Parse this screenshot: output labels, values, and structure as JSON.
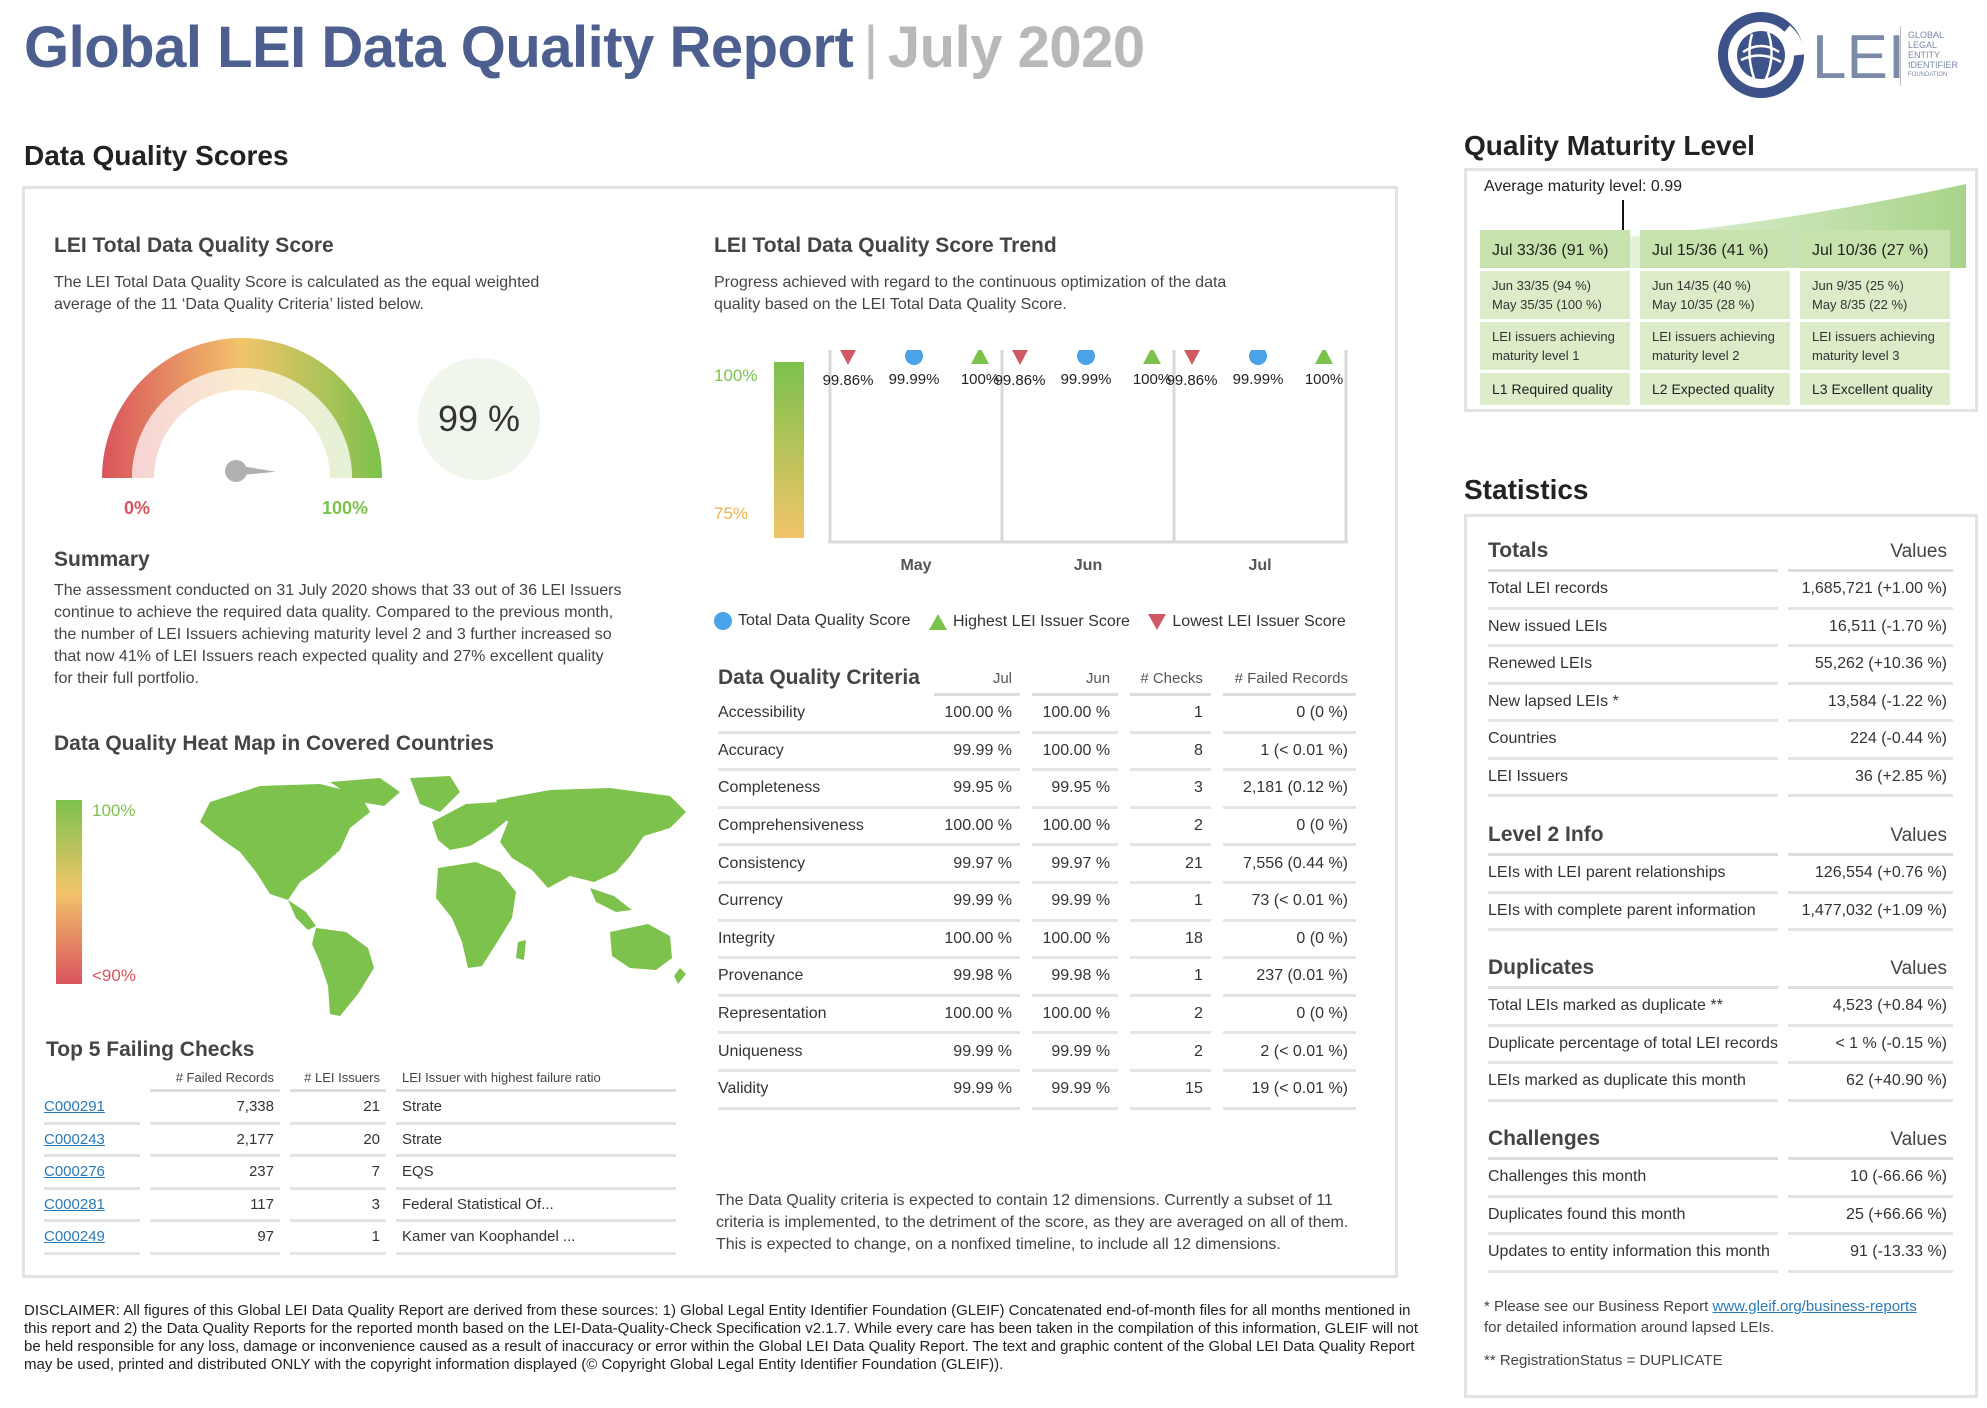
{
  "header": {
    "title": "Global LEI Data Quality Report",
    "separator": "|",
    "date": "July 2020",
    "logo_text": "LEI",
    "logo_small": [
      "GLOBAL",
      "LEGAL",
      "ENTITY",
      "IDENTIFIER",
      "FOUNDATION"
    ]
  },
  "dq_scores": {
    "section_title": "Data Quality Scores",
    "total": {
      "title": "LEI Total Data Quality Score",
      "description": "The LEI Total Data Quality Score is calculated as the equal weighted average of the 11 ‘Data Quality Criteria’ listed below.",
      "gauge_min_label": "0%",
      "gauge_max_label": "100%",
      "gauge_value": 0.99,
      "score": "99 %"
    },
    "summary": {
      "title": "Summary",
      "text": "The assessment conducted on 31 July 2020 shows that 33 out of 36 LEI Issuers continue to achieve the required data quality. Compared to the previous month, the number of LEI Issuers achieving maturity level 2 and 3 further increased so that now 41% of LEI Issuers reach expected quality and 27% excellent quality for their full portfolio."
    },
    "heatmap": {
      "title": "Data Quality Heat Map in Covered Countries",
      "max_label": "100%",
      "min_label": "<90%"
    },
    "top5": {
      "title": "Top 5 Failing Checks",
      "columns": [
        "# Failed Records",
        "# LEI Issuers",
        "LEI Issuer with highest failure ratio"
      ],
      "rows": [
        {
          "check": "C000291",
          "failed": "7,338",
          "issuers": "21",
          "issuer": "Strate"
        },
        {
          "check": "C000243",
          "failed": "2,177",
          "issuers": "20",
          "issuer": "Strate"
        },
        {
          "check": "C000276",
          "failed": "237",
          "issuers": "7",
          "issuer": "EQS"
        },
        {
          "check": "C000281",
          "failed": "117",
          "issuers": "3",
          "issuer": "Federal Statistical Of..."
        },
        {
          "check": "C000249",
          "failed": "97",
          "issuers": "1",
          "issuer": "Kamer van Koophandel ..."
        }
      ]
    },
    "trend": {
      "title": "LEI Total Data Quality Score Trend",
      "description": "Progress achieved with regard to the continuous optimization of the data quality based on the LEI Total Data Quality Score.",
      "scale_top": "100%",
      "scale_bottom": "75%",
      "legend": {
        "total": "Total Data Quality Score",
        "highest": "Highest LEI Issuer Score",
        "lowest": "Lowest LEI Issuer Score"
      },
      "colors": {
        "total": "#4aa3e8",
        "highest": "#7cc24c",
        "lowest": "#d05a64"
      }
    },
    "criteria": {
      "title": "Data Quality Criteria",
      "columns": [
        "Jul",
        "Jun",
        "# Checks",
        "# Failed Records"
      ],
      "rows": [
        {
          "name": "Accessibility",
          "jul": "100.00 %",
          "jun": "100.00 %",
          "checks": "1",
          "failed": "0 (0 %)"
        },
        {
          "name": "Accuracy",
          "jul": "99.99 %",
          "jun": "100.00 %",
          "checks": "8",
          "failed": "1 (< 0.01 %)"
        },
        {
          "name": "Completeness",
          "jul": "99.95 %",
          "jun": "99.95 %",
          "checks": "3",
          "failed": "2,181 (0.12 %)"
        },
        {
          "name": "Comprehensiveness",
          "jul": "100.00 %",
          "jun": "100.00 %",
          "checks": "2",
          "failed": "0 (0 %)"
        },
        {
          "name": "Consistency",
          "jul": "99.97 %",
          "jun": "99.97 %",
          "checks": "21",
          "failed": "7,556 (0.44 %)"
        },
        {
          "name": "Currency",
          "jul": "99.99 %",
          "jun": "99.99 %",
          "checks": "1",
          "failed": "73 (< 0.01 %)"
        },
        {
          "name": "Integrity",
          "jul": "100.00 %",
          "jun": "100.00 %",
          "checks": "18",
          "failed": "0 (0 %)"
        },
        {
          "name": "Provenance",
          "jul": "99.98 %",
          "jun": "99.98 %",
          "checks": "1",
          "failed": "237 (0.01 %)"
        },
        {
          "name": "Representation",
          "jul": "100.00 %",
          "jun": "100.00 %",
          "checks": "2",
          "failed": "0 (0 %)"
        },
        {
          "name": "Uniqueness",
          "jul": "99.99 %",
          "jun": "99.99 %",
          "checks": "2",
          "failed": "2 (< 0.01 %)"
        },
        {
          "name": "Validity",
          "jul": "99.99 %",
          "jun": "99.99 %",
          "checks": "15",
          "failed": "19 (< 0.01 %)"
        }
      ],
      "note": "The Data Quality criteria is expected to contain 12 dimensions. Currently a subset of 11 criteria is implemented, to the detriment of the score, as they are averaged on all of them. This is expected to change, on a nonfixed timeline, to include all 12 dimensions."
    }
  },
  "chart_data": {
    "type": "scatter",
    "title": "LEI Total Data Quality Score Trend",
    "categories": [
      "May",
      "Jun",
      "Jul"
    ],
    "ylim": [
      75,
      100
    ],
    "series": [
      {
        "name": "Lowest LEI Issuer Score",
        "values": [
          99.86,
          99.86,
          99.86
        ],
        "labels": [
          "99.86%",
          "99.86%",
          "99.86%"
        ]
      },
      {
        "name": "Total Data Quality Score",
        "values": [
          99.99,
          99.99,
          99.99
        ],
        "labels": [
          "99.99%",
          "99.99%",
          "99.99%"
        ]
      },
      {
        "name": "Highest LEI Issuer Score",
        "values": [
          100,
          100,
          100
        ],
        "labels": [
          "100%",
          "100%",
          "100%"
        ]
      }
    ]
  },
  "maturity": {
    "section_title": "Quality Maturity Level",
    "average": "Average maturity level: 0.99",
    "average_value": 0.99,
    "levels": [
      {
        "head": "Jul 33/36 (91 %)",
        "jun": "Jun 33/35 (94 %)",
        "may": "May 35/35 (100 %)",
        "desc1": "LEI issuers achieving",
        "desc2": "maturity level 1",
        "foot": "L1 Required quality"
      },
      {
        "head": "Jul 15/36 (41 %)",
        "jun": "Jun 14/35 (40 %)",
        "may": "May 10/35 (28 %)",
        "desc1": "LEI issuers achieving",
        "desc2": "maturity level 2",
        "foot": "L2 Expected quality"
      },
      {
        "head": "Jul 10/36 (27 %)",
        "jun": "Jun 9/35 (25 %)",
        "may": "May 8/35 (22 %)",
        "desc1": "LEI issuers achieving",
        "desc2": "maturity level 3",
        "foot": "L3 Excellent quality"
      }
    ]
  },
  "statistics": {
    "section_title": "Statistics",
    "groups": [
      {
        "title": "Totals",
        "values_label": "Values",
        "rows": [
          {
            "k": "Total LEI records",
            "v": "1,685,721 (+1.00 %)"
          },
          {
            "k": "New issued LEIs",
            "v": "16,511 (-1.70 %)"
          },
          {
            "k": "Renewed LEIs",
            "v": "55,262 (+10.36 %)"
          },
          {
            "k": "New lapsed LEIs *",
            "v": "13,584 (-1.22 %)"
          },
          {
            "k": "Countries",
            "v": "224 (-0.44 %)"
          },
          {
            "k": "LEI Issuers",
            "v": "36 (+2.85 %)"
          }
        ]
      },
      {
        "title": "Level 2 Info",
        "values_label": "Values",
        "rows": [
          {
            "k": "LEIs with LEI parent relationships",
            "v": "126,554 (+0.76 %)"
          },
          {
            "k": "LEIs with complete parent information",
            "v": "1,477,032 (+1.09 %)"
          }
        ]
      },
      {
        "title": "Duplicates",
        "values_label": "Values",
        "rows": [
          {
            "k": "Total LEIs marked as duplicate **",
            "v": "4,523 (+0.84 %)"
          },
          {
            "k": "Duplicate percentage of total LEI records",
            "v": "< 1 % (-0.15 %)"
          },
          {
            "k": "LEIs marked as duplicate this month",
            "v": "62 (+40.90 %)"
          }
        ]
      },
      {
        "title": "Challenges",
        "values_label": "Values",
        "rows": [
          {
            "k": "Challenges this month",
            "v": "10 (-66.66 %)"
          },
          {
            "k": "Duplicates found this month",
            "v": "25 (+66.66 %)"
          },
          {
            "k": "Updates to entity information this month",
            "v": "91 (-13.33 %)"
          }
        ]
      }
    ],
    "footnote1_pre": "* Please see our Business Report ",
    "footnote1_link": "www.gleif.org/business-reports",
    "footnote1_post": "for detailed information around lapsed LEIs.",
    "footnote2": "** RegistrationStatus = DUPLICATE"
  },
  "disclaimer": "DISCLAIMER: All figures of this Global LEI Data Quality Report are derived from these sources: 1) Global Legal Entity Identifier Foundation (GLEIF) Concatenated end-of-month files for all months mentioned in this report and 2) the Data Quality Reports for the reported month based on the LEI-Data-Quality-Check Specification v2.1.7. While every care has been taken in the compilation of this information, GLEIF will not be held responsible for any loss, damage or inconvenience caused as a result of inaccuracy or error within the Global LEI Data Quality Report. The text and graphic content of the Global LEI Data Quality Report may be used, printed and distributed ONLY with the copyright information displayed (© Copyright Global Legal Entity Identifier Foundation (GLEIF))."
}
